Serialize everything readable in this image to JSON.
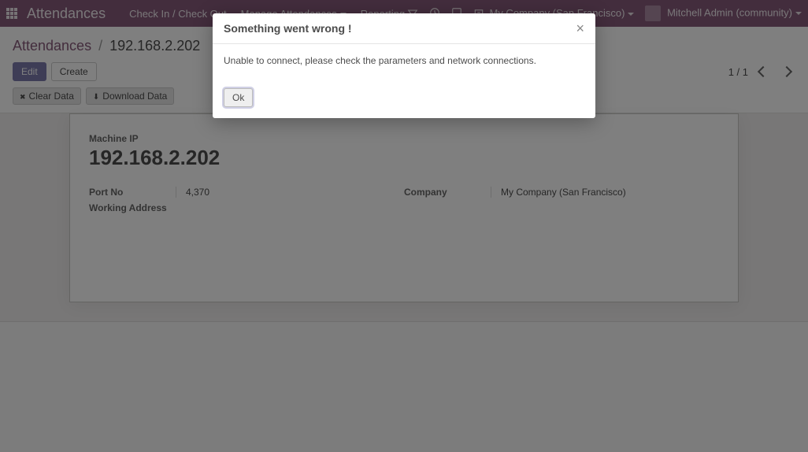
{
  "navbar": {
    "app_title": "Attendances",
    "menu_items": [
      "Check In / Check Out",
      "Manage Attendances",
      "Reporting"
    ],
    "company": "My Company (San Francisco)",
    "user": "Mitchell Admin (community)"
  },
  "breadcrumb": {
    "root": "Attendances",
    "current": "192.168.2.202"
  },
  "buttons": {
    "edit": "Edit",
    "create": "Create",
    "clear_data": "Clear Data",
    "download_data": "Download Data"
  },
  "pager": {
    "text": "1 / 1"
  },
  "form": {
    "title_label": "Machine IP",
    "title_value": "192.168.2.202",
    "left": [
      {
        "label": "Port No",
        "value": "4,370"
      },
      {
        "label": "Working Address",
        "value": ""
      }
    ],
    "right": [
      {
        "label": "Company",
        "value": "My Company (San Francisco)"
      }
    ]
  },
  "modal": {
    "title": "Something went wrong !",
    "body": "Unable to connect, please check the parameters and network connections.",
    "ok": "Ok"
  }
}
